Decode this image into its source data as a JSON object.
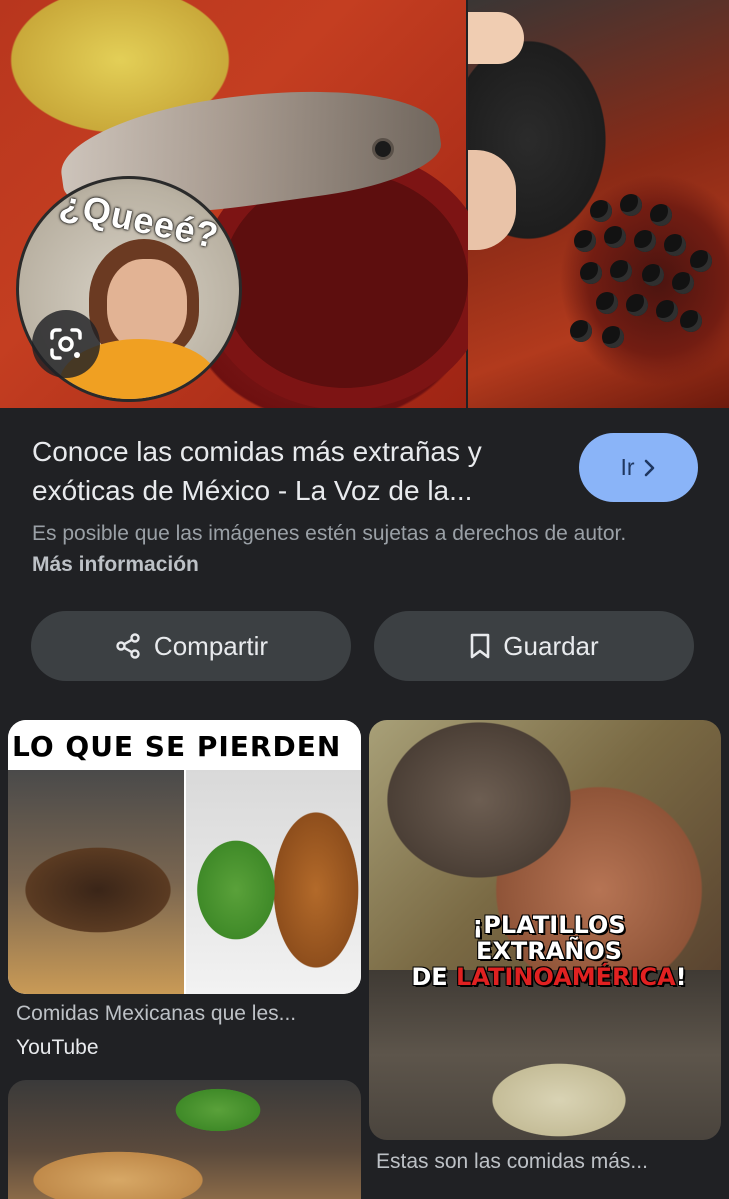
{
  "hero": {
    "sticker_text": "¿Queeé?",
    "lens_icon": "google-lens-icon"
  },
  "result": {
    "title": "Conoce las comidas más extrañas y exóticas de México - La Voz de la...",
    "go_button": "Ir",
    "notice": "Es posible que las imágenes estén sujetas a derechos de autor.",
    "more_info": "Más información"
  },
  "actions": {
    "share_label": "Compartir",
    "save_label": "Guardar"
  },
  "related": [
    {
      "overlay_text": "LO QUE SE PIERDEN",
      "caption": "Comidas Mexicanas que les...",
      "source": "YouTube"
    },
    {
      "overlay_line1": "¡PLATILLOS EXTRAÑOS",
      "overlay_line2_prefix": "DE ",
      "overlay_line2_red": "LATINOAMÉRICA",
      "overlay_line2_suffix": "!",
      "caption": "Estas son las comidas más..."
    }
  ],
  "colors": {
    "background": "#202124",
    "button_surface": "#3c4043",
    "accent": "#8ab4f8"
  }
}
